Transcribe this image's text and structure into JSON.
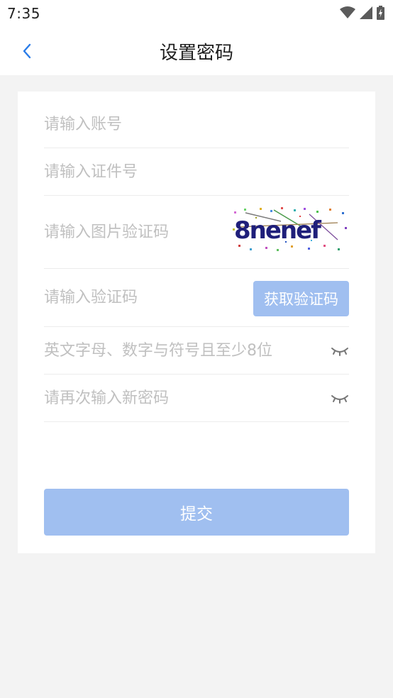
{
  "status_bar": {
    "time": "7:35"
  },
  "header": {
    "title": "设置密码",
    "back_icon": "chevron-left-icon"
  },
  "form": {
    "account_placeholder": "请输入账号",
    "id_placeholder": "请输入证件号",
    "image_captcha_placeholder": "请输入图片验证码",
    "captcha_text": "8nenef",
    "sms_code_placeholder": "请输入验证码",
    "get_code_label": "获取验证码",
    "password_placeholder": "英文字母、数字与符号且至少8位",
    "confirm_password_placeholder": "请再次输入新密码",
    "submit_label": "提交"
  },
  "colors": {
    "accent": "#2a7ce8",
    "button_disabled": "#a0bff0",
    "background": "#f3f3f3",
    "placeholder": "#c0c0c0"
  }
}
